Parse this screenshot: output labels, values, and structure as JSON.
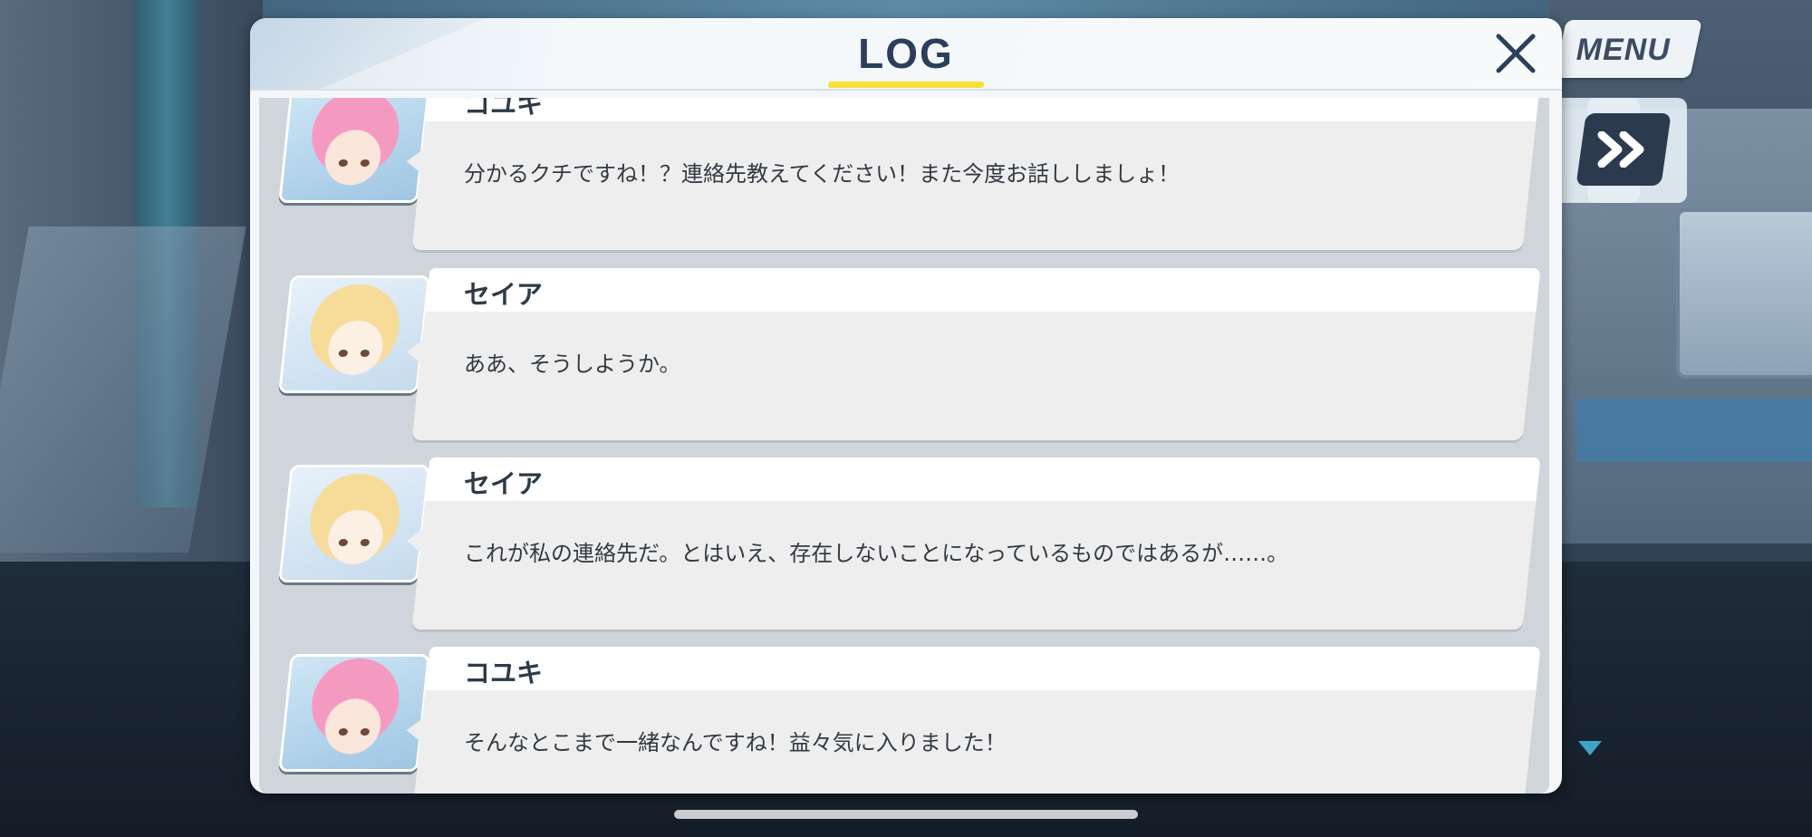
{
  "hud": {
    "menu_label": "MENU",
    "fast_forward_icon": "double-chevron-right-icon",
    "scroll_indicator_icon": "triangle-down-icon"
  },
  "log": {
    "title": "LOG",
    "close_icon": "close-icon",
    "accent_color": "#f5e13a",
    "entries": [
      {
        "speaker": "コユキ",
        "portrait": "koyuki-portrait",
        "text": "分かるクチですね！？連絡先教えてください！また今度お話ししましょ！"
      },
      {
        "speaker": "セイア",
        "portrait": "seia-portrait",
        "text": "ああ、そうしようか。"
      },
      {
        "speaker": "セイア",
        "portrait": "seia-portrait",
        "text": "これが私の連絡先だ。とはいえ、存在しないことになっているものではあるが……。"
      },
      {
        "speaker": "コユキ",
        "portrait": "koyuki-portrait",
        "text": "そんなとこまで一緒なんですね！益々気に入りました！"
      }
    ]
  }
}
